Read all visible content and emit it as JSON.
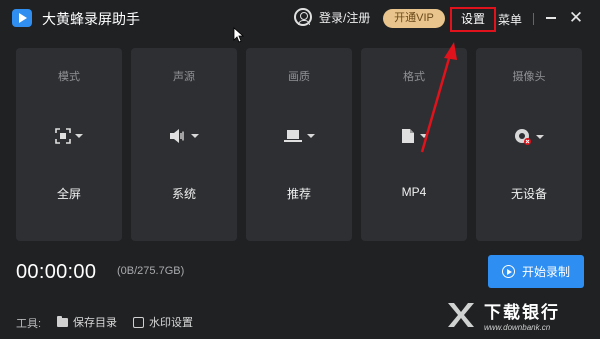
{
  "titlebar": {
    "app_title": "大黄蜂录屏助手",
    "login_label": "登录/注册",
    "vip_label": "开通VIP",
    "settings_label": "设置",
    "menu_label": "菜单",
    "close_glyph": "✕"
  },
  "cards": [
    {
      "title": "模式",
      "value": "全屏",
      "icon": "fullscreen-icon"
    },
    {
      "title": "声源",
      "value": "系统",
      "icon": "speaker-icon"
    },
    {
      "title": "画质",
      "value": "推荐",
      "icon": "laptop-icon"
    },
    {
      "title": "格式",
      "value": "MP4",
      "icon": "file-icon"
    },
    {
      "title": "摄像头",
      "value": "无设备",
      "icon": "webcam-disabled-icon"
    }
  ],
  "status": {
    "timer": "00:00:00",
    "storage": "(0B/275.7GB)"
  },
  "record": {
    "label": "开始录制"
  },
  "tools": {
    "label": "工具:",
    "save_dir": "保存目录",
    "watermark": "水印设置"
  },
  "watermark": {
    "title": "下载银行",
    "url": "www.downbank.cn"
  },
  "colors": {
    "background": "#1f2123",
    "card": "#2d2f32",
    "accent": "#2e8ef2",
    "vip": "#e9c48c",
    "highlight": "#e0121b"
  }
}
